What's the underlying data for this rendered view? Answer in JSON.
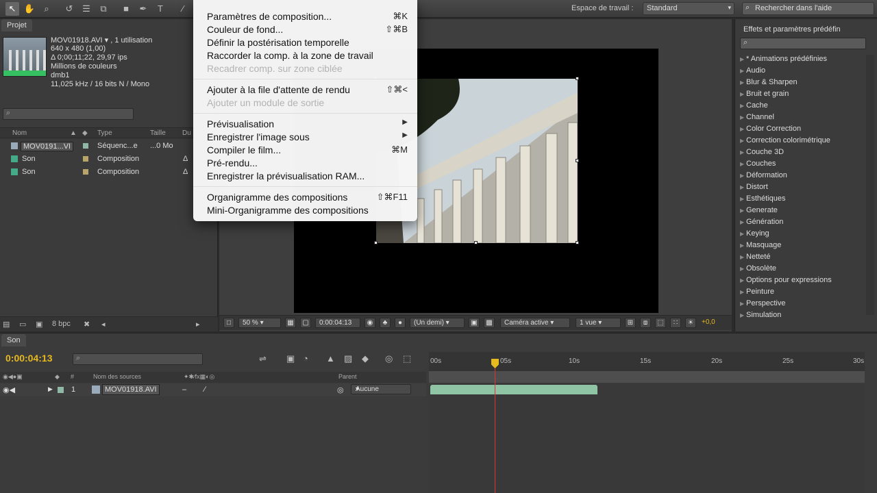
{
  "toolbar": {
    "workspace_label": "Espace de travail :",
    "workspace_value": "Standard",
    "help_search_placeholder": "Rechercher dans l'aide"
  },
  "project": {
    "tab": "Projet",
    "file_name": "MOV01918.AVI ▾ , 1 utilisation",
    "info": [
      "640 x 480 (1,00)",
      "Δ 0;00;11;22, 29,97 ips",
      "Millions de couleurs",
      "dmb1",
      "11,025 kHz / 16 bits N / Mono"
    ],
    "columns": [
      "Nom",
      "Type",
      "Taille",
      "Du"
    ],
    "rows": [
      {
        "name": "MOV0191...VI",
        "type": "Séquenc...e",
        "size": "...0 Mo",
        "swatch": "#8fb8a6"
      },
      {
        "name": "Son",
        "type": "Composition",
        "size": "",
        "swatch": "#b9a46a"
      },
      {
        "name": "Son",
        "type": "Composition",
        "size": "",
        "swatch": "#b9a46a"
      }
    ],
    "bpc": "8 bpc"
  },
  "viewer": {
    "zoom": "50 %",
    "timecode": "0:00:04:13",
    "resolution": "(Un demi)",
    "camera": "Caméra active",
    "views": "1 vue",
    "exposure": "+0,0"
  },
  "effects": {
    "tab": "Effets et paramètres prédéfin",
    "items": [
      "* Animations prédéfinies",
      "Audio",
      "Blur & Sharpen",
      "Bruit et grain",
      "Cache",
      "Channel",
      "Color Correction",
      "Correction colorimétrique",
      "Couche 3D",
      "Couches",
      "Déformation",
      "Distort",
      "Esthétiques",
      "Generate",
      "Génération",
      "Keying",
      "Masquage",
      "Netteté",
      "Obsolète",
      "Options pour expressions",
      "Peinture",
      "Perspective",
      "Simulation"
    ]
  },
  "timeline": {
    "tab": "Son",
    "time": "0:00:04:13",
    "columns": {
      "num": "#",
      "source": "Nom des sources",
      "parent": "Parent"
    },
    "layer": {
      "index": "1",
      "name": "MOV01918.AVI",
      "parent": "Aucune"
    },
    "ruler_labels": [
      "00s",
      "05s",
      "10s",
      "15s",
      "20s",
      "25s",
      "30s"
    ]
  },
  "menu": {
    "items": [
      {
        "label": "Paramètres de composition...",
        "shortcut": "⌘K",
        "disabled": false
      },
      {
        "label": "Couleur de fond...",
        "shortcut": "⇧⌘B",
        "disabled": false
      },
      {
        "label": "Définir la postérisation temporelle",
        "shortcut": "",
        "disabled": false
      },
      {
        "label": "Raccorder la comp. à la zone de travail",
        "shortcut": "",
        "disabled": false
      },
      {
        "label": "Recadrer comp. sur zone ciblée",
        "shortcut": "",
        "disabled": true
      },
      {
        "label": "Ajouter à la file d'attente de rendu",
        "shortcut": "⇧⌘<",
        "disabled": false
      },
      {
        "label": "Ajouter un module de sortie",
        "shortcut": "",
        "disabled": true
      },
      {
        "label": "Prévisualisation",
        "shortcut": "",
        "disabled": false
      },
      {
        "label": "Enregistrer l'image sous",
        "shortcut": "",
        "disabled": false
      },
      {
        "label": "Compiler le film...",
        "shortcut": "⌘M",
        "disabled": false
      },
      {
        "label": "Pré-rendu...",
        "shortcut": "",
        "disabled": false
      },
      {
        "label": "Enregistrer la prévisualisation RAM...",
        "shortcut": "",
        "disabled": false
      },
      {
        "label": "Organigramme des compositions",
        "shortcut": "⇧⌘F11",
        "disabled": false
      },
      {
        "label": "Mini-Organigramme des compositions",
        "shortcut": "",
        "disabled": false
      }
    ]
  }
}
